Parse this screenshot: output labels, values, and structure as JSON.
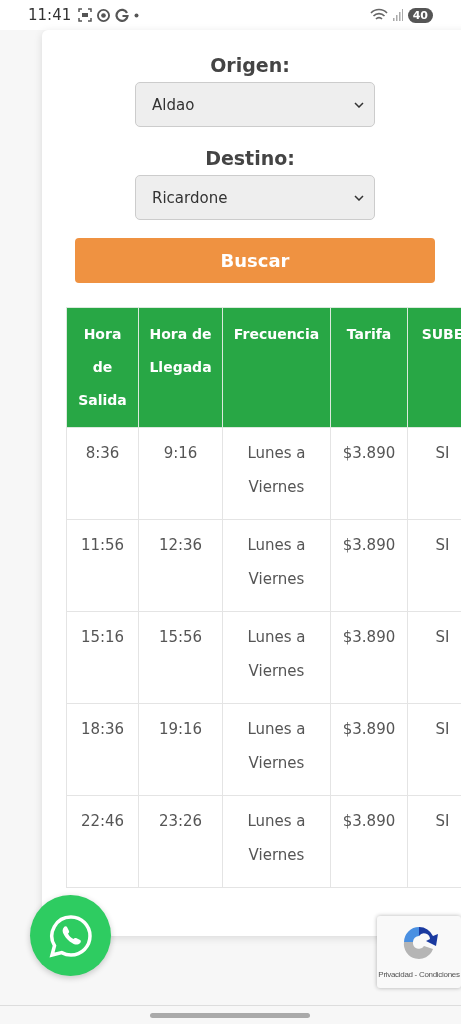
{
  "status_bar": {
    "time": "11:41",
    "battery": "40"
  },
  "form": {
    "origin_label": "Origen:",
    "origin_value": "Aldao",
    "destination_label": "Destino:",
    "destination_value": "Ricardone",
    "search_button": "Buscar"
  },
  "table": {
    "columns": [
      "Hora de Salida",
      "Hora de Llegada",
      "Frecuencia",
      "Tarifa",
      "SUBE"
    ],
    "rows": [
      [
        "8:36",
        "9:16",
        "Lunes a Viernes",
        "$3.890",
        "SI"
      ],
      [
        "11:56",
        "12:36",
        "Lunes a Viernes",
        "$3.890",
        "SI"
      ],
      [
        "15:16",
        "15:56",
        "Lunes a Viernes",
        "$3.890",
        "SI"
      ],
      [
        "18:36",
        "19:16",
        "Lunes a Viernes",
        "$3.890",
        "SI"
      ],
      [
        "22:46",
        "23:26",
        "Lunes a Viernes",
        "$3.890",
        "SI"
      ]
    ]
  },
  "recaptcha": {
    "links": "Privacidad - Condiciones"
  }
}
